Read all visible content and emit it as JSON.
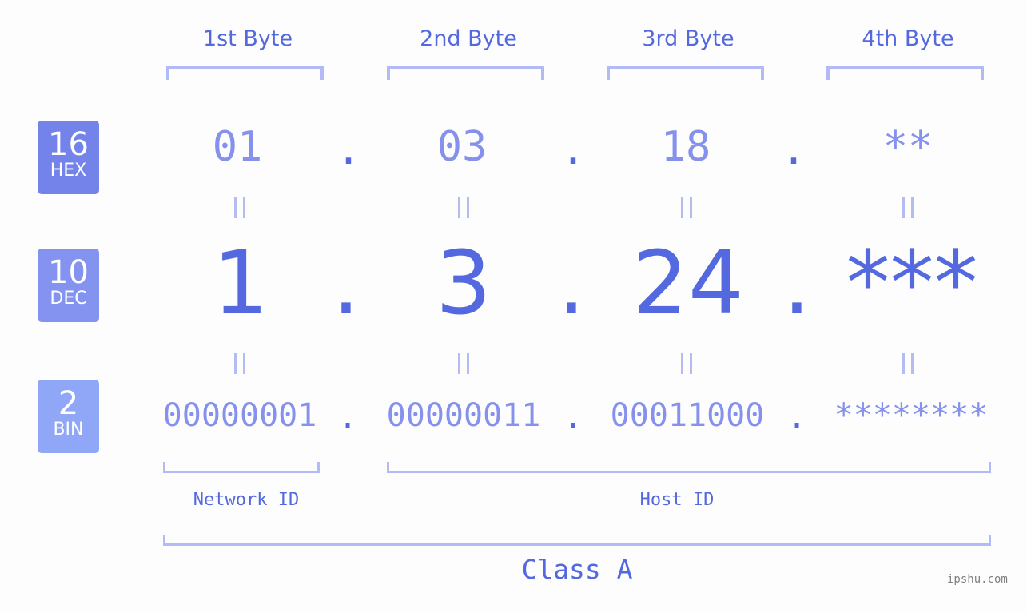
{
  "byte_headers": [
    "1st Byte",
    "2nd Byte",
    "3rd Byte",
    "4th Byte"
  ],
  "bases": [
    {
      "number": "16",
      "label": "HEX",
      "color": "#7383ea"
    },
    {
      "number": "10",
      "label": "DEC",
      "color": "#8493f0"
    },
    {
      "number": "2",
      "label": "BIN",
      "color": "#90a7f8"
    }
  ],
  "hex": [
    "01",
    "03",
    "18",
    "**"
  ],
  "dec": [
    "1",
    "3",
    "24",
    "***"
  ],
  "bin": [
    "00000001",
    "00000011",
    "00011000",
    "********"
  ],
  "separator": ".",
  "network_id_label": "Network ID",
  "host_id_label": "Host ID",
  "class_label": "Class A",
  "watermark": "ipshu.com",
  "colors": {
    "accent": "#5468e0",
    "muted": "#8591ec",
    "bracket": "#b2bbf6",
    "background": "#fcfdfc"
  }
}
